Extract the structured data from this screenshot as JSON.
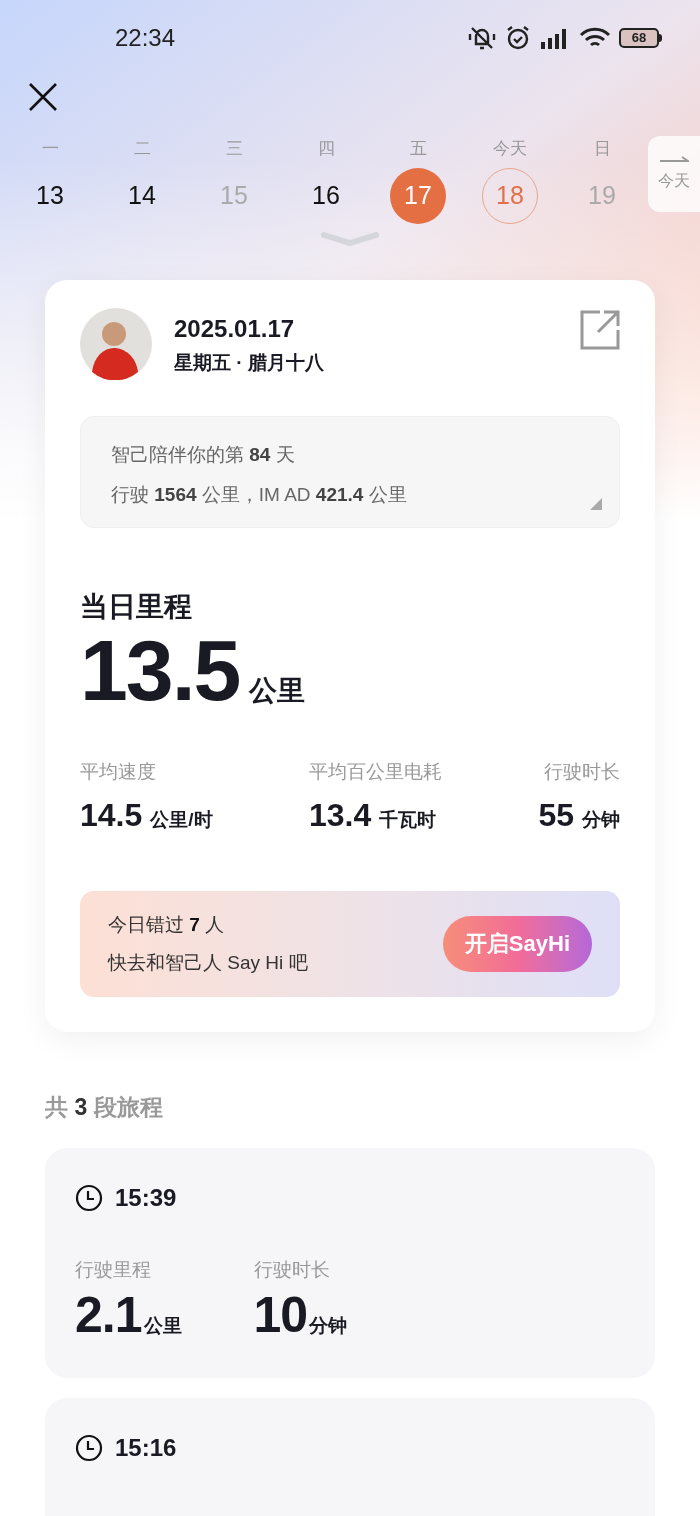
{
  "status_bar": {
    "time": "22:34",
    "battery": "68"
  },
  "calendar": {
    "days": [
      {
        "weekday": "一",
        "date": "13",
        "has_trips": true,
        "selected": false,
        "today": false
      },
      {
        "weekday": "二",
        "date": "14",
        "has_trips": true,
        "selected": false,
        "today": false
      },
      {
        "weekday": "三",
        "date": "15",
        "has_trips": false,
        "selected": false,
        "today": false
      },
      {
        "weekday": "四",
        "date": "16",
        "has_trips": true,
        "selected": false,
        "today": false
      },
      {
        "weekday": "五",
        "date": "17",
        "has_trips": true,
        "selected": true,
        "today": false
      },
      {
        "weekday": "今天",
        "date": "18",
        "has_trips": true,
        "selected": false,
        "today": true
      },
      {
        "weekday": "日",
        "date": "19",
        "has_trips": false,
        "selected": false,
        "today": false
      }
    ],
    "today_button": "今天"
  },
  "summary": {
    "date": "2025.01.17",
    "weekday_lunar": "星期五 · 腊月十八",
    "info_lines": [
      "智己陪伴你的第 **84** 天",
      "行驶 **1564** 公里，IM AD **421.4** 公里"
    ],
    "mileage_label": "当日里程",
    "mileage_value": "13.5",
    "mileage_unit": "公里",
    "stats": [
      {
        "label": "平均速度",
        "value": "14.5",
        "unit": "公里/时"
      },
      {
        "label": "平均百公里电耗",
        "value": "13.4",
        "unit": "千瓦时"
      },
      {
        "label": "行驶时长",
        "value": "55",
        "unit": "分钟"
      }
    ],
    "sayhi": {
      "lines": [
        "今日错过 **7** 人",
        "快去和智己人 Say Hi 吧"
      ],
      "button": "开启SayHi"
    }
  },
  "trips_title": "共 **3** 段旅程",
  "trips": [
    {
      "time": "15:39",
      "stats": [
        {
          "label": "行驶里程",
          "value": "2.1",
          "unit": "公里"
        },
        {
          "label": "行驶时长",
          "value": "10",
          "unit": "分钟"
        }
      ]
    },
    {
      "time": "15:16"
    }
  ]
}
